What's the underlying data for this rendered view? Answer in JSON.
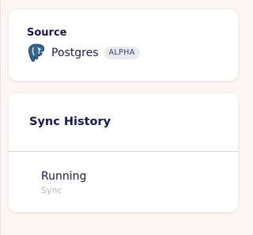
{
  "source": {
    "title": "Source",
    "connector_name": "Postgres",
    "connector_icon": "postgres-elephant-icon",
    "badge": "ALPHA"
  },
  "sync_history": {
    "title": "Sync History",
    "jobs": [
      {
        "status": "Running",
        "type": "Sync"
      }
    ]
  },
  "colors": {
    "background": "#fdf6f2",
    "text": "#1a194d",
    "badge_bg": "#e9e9f1",
    "postgres_blue": "#336791"
  }
}
